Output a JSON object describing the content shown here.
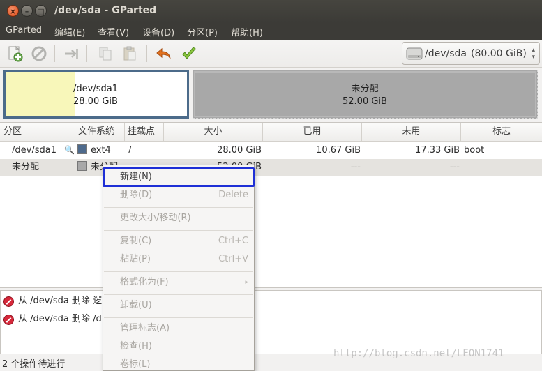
{
  "window": {
    "title": "/dev/sda - GParted"
  },
  "menubar": {
    "items": [
      {
        "label": "GParted"
      },
      {
        "label": "编辑(E)"
      },
      {
        "label": "查看(V)"
      },
      {
        "label": "设备(D)"
      },
      {
        "label": "分区(P)"
      },
      {
        "label": "帮助(H)"
      }
    ]
  },
  "toolbar": {
    "icons": [
      "new-partition-icon",
      "delete-icon",
      "resize-move-icon",
      "copy-icon",
      "paste-icon",
      "undo-icon",
      "apply-icon"
    ]
  },
  "device": {
    "label": "/dev/sda",
    "size": "(80.00 GiB)"
  },
  "partition_map": {
    "sda1": {
      "name": "/dev/sda1",
      "size": "28.00 GiB",
      "used_fraction": 0.38
    },
    "unallocated": {
      "name": "未分配",
      "size": "52.00 GiB"
    }
  },
  "table": {
    "headers": [
      "分区",
      "文件系统",
      "挂载点",
      "大小",
      "已用",
      "未用",
      "标志"
    ],
    "rows": [
      {
        "partition": "/dev/sda1",
        "filesystem": "ext4",
        "fs_color": "#4e6a8c",
        "mount": "/",
        "size": "28.00 GiB",
        "used": "10.67 GiB",
        "unused": "17.33 GiB",
        "flags": "boot"
      },
      {
        "partition": "未分配",
        "filesystem": "未分配",
        "fs_color": "#a8a8a8",
        "mount": "",
        "size": "52.00 GiB",
        "used": "---",
        "unused": "---",
        "flags": ""
      }
    ]
  },
  "log": {
    "items": [
      {
        "text": "从 /dev/sda 删除 逻"
      },
      {
        "text": "从 /dev/sda 删除 /d"
      }
    ]
  },
  "status": {
    "text": "2 个操作待进行"
  },
  "context_menu": {
    "items": [
      {
        "label": "新建(N)",
        "accel": "",
        "enabled": true
      },
      {
        "label": "删除(D)",
        "accel": "Delete",
        "enabled": false
      },
      {
        "label": "更改大小/移动(R)",
        "accel": "",
        "enabled": false
      },
      {
        "label": "复制(C)",
        "accel": "Ctrl+C",
        "enabled": false
      },
      {
        "label": "粘贴(P)",
        "accel": "Ctrl+V",
        "enabled": false
      },
      {
        "label": "格式化为(F)",
        "accel": "",
        "submenu_arrow": "▸",
        "enabled": false
      },
      {
        "label": "卸载(U)",
        "accel": "",
        "enabled": false
      },
      {
        "label": "管理标志(A)",
        "accel": "",
        "enabled": false
      },
      {
        "label": "检查(H)",
        "accel": "",
        "enabled": false
      },
      {
        "label": "卷标(L)",
        "accel": "",
        "enabled": false
      }
    ]
  },
  "watermark": {
    "text": "http://blog.csdn.net/LEON1741"
  }
}
